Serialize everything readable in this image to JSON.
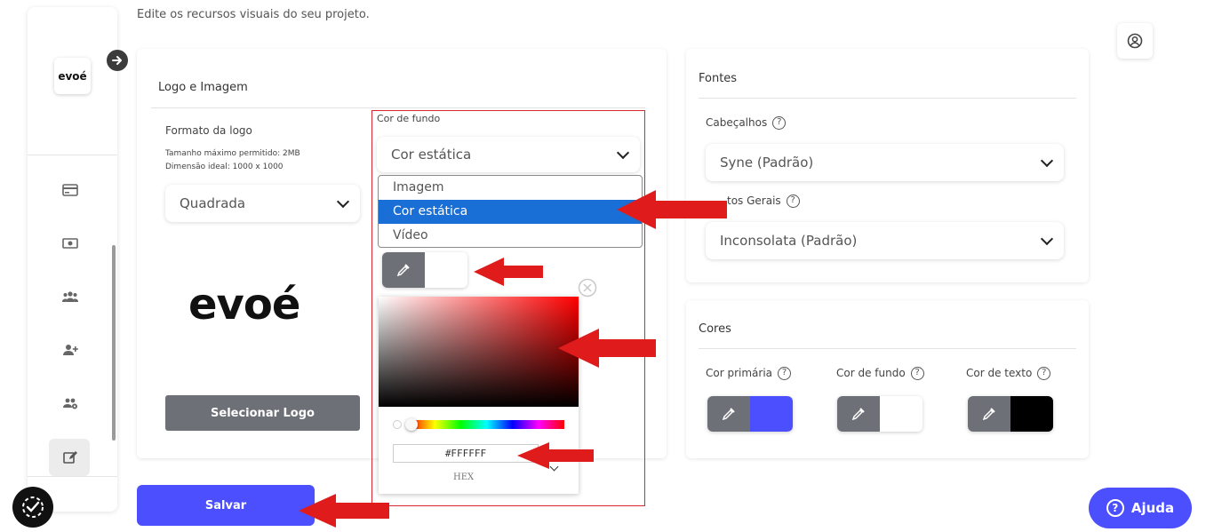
{
  "header": {
    "subtitle": "Edite os recursos visuais do seu projeto."
  },
  "sidebar": {
    "logo_text": "evoé",
    "items": [
      {
        "icon": "card-icon"
      },
      {
        "icon": "money-icon"
      },
      {
        "icon": "users-icon"
      },
      {
        "icon": "user-add-icon"
      },
      {
        "icon": "group-settings-icon"
      },
      {
        "icon": "edit-icon",
        "active": true
      }
    ]
  },
  "logo_panel": {
    "title": "Logo e Imagem",
    "format_label": "Formato da logo",
    "max_size": "Tamanho máximo permitido: 2MB",
    "ideal_dim": "Dimensão ideal: 1000 x 1000",
    "format_value": "Quadrada",
    "preview_text": "evoé",
    "select_button": "Selecionar Logo"
  },
  "background": {
    "label": "Cor de fundo",
    "selected": "Cor estática",
    "options": [
      "Imagem",
      "Cor estática",
      "Vídeo"
    ],
    "picker": {
      "hex_value": "#FFFFFF",
      "mode_label": "HEX"
    }
  },
  "fonts_panel": {
    "title": "Fontes",
    "headers_label": "Cabeçalhos",
    "headers_value": "Syne (Padrão)",
    "general_label": "Textos Gerais",
    "general_label_visible": "tos Gerais",
    "general_value": "Inconsolata (Padrão)"
  },
  "colors_panel": {
    "title": "Cores",
    "items": [
      {
        "label": "Cor primária",
        "color": "#4c4ffe"
      },
      {
        "label": "Cor de fundo",
        "color": "#ffffff"
      },
      {
        "label": "Cor de texto",
        "color": "#000000"
      }
    ]
  },
  "save_button": "Salvar",
  "help_button": "Ajuda",
  "colors": {
    "accent": "#4c4ffe",
    "highlight": "#1a6fd6",
    "annotation": "#e01b1b"
  }
}
